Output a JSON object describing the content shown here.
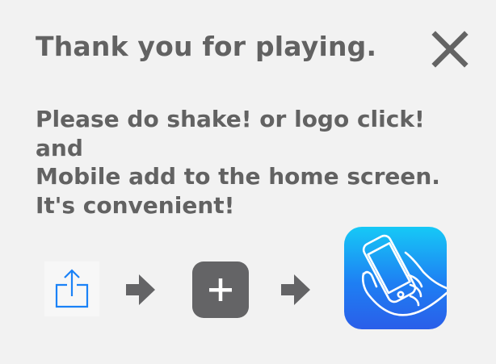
{
  "dialog": {
    "title": "Thank you for playing.",
    "close_icon": "close-icon",
    "message_lines": [
      "Please do shake! or logo click!",
      "and",
      "Mobile add to the home screen.",
      "It's convenient!"
    ]
  },
  "steps": [
    {
      "icon": "share-icon",
      "color": "#1a82f7"
    },
    {
      "icon": "arrow-right-icon",
      "color": "#646466"
    },
    {
      "icon": "plus-icon",
      "color": "#646466"
    },
    {
      "icon": "arrow-right-icon",
      "color": "#646466"
    },
    {
      "icon": "phone-in-hand-icon",
      "color": "#1e7ff3"
    }
  ],
  "colors": {
    "background": "#f2f2f2",
    "text": "#626262",
    "accent_blue": "#1a82f7"
  }
}
